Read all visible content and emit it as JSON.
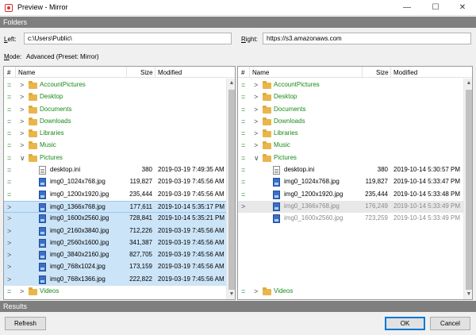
{
  "window": {
    "title": "Preview - Mirror",
    "controls": {
      "minimize": "—",
      "maximize": "☐",
      "close": "✕"
    }
  },
  "sections": {
    "folders": "Folders",
    "results": "Results"
  },
  "paths": {
    "left_label_u": "L",
    "left_label_rest": "eft:",
    "left_value": "c:\\Users\\Public\\",
    "right_label_u": "R",
    "right_label_rest": "ight:",
    "right_value": "https://s3.amazonaws.com",
    "mode_label_u": "M",
    "mode_label_rest": "ode:",
    "mode_value": "Advanced (Preset: Mirror)"
  },
  "columns": {
    "hash": "#",
    "name": "Name",
    "size": "Size",
    "modified": "Modified"
  },
  "left_rows": [
    {
      "mark": "=",
      "exp": ">",
      "type": "folder",
      "name": "AccountPictures",
      "size": "",
      "modified": "",
      "style": ""
    },
    {
      "mark": "=",
      "exp": ">",
      "type": "folder",
      "name": "Desktop",
      "size": "",
      "modified": "",
      "style": ""
    },
    {
      "mark": "=",
      "exp": ">",
      "type": "folder",
      "name": "Documents",
      "size": "",
      "modified": "",
      "style": ""
    },
    {
      "mark": "=",
      "exp": ">",
      "type": "folder",
      "name": "Downloads",
      "size": "",
      "modified": "",
      "style": ""
    },
    {
      "mark": "=",
      "exp": ">",
      "type": "folder",
      "name": "Libraries",
      "size": "",
      "modified": "",
      "style": ""
    },
    {
      "mark": "=",
      "exp": ">",
      "type": "folder",
      "name": "Music",
      "size": "",
      "modified": "",
      "style": ""
    },
    {
      "mark": "=",
      "exp": "∨",
      "type": "folder",
      "name": "Pictures",
      "size": "",
      "modified": "",
      "style": ""
    },
    {
      "mark": "=",
      "exp": "",
      "type": "file",
      "name": "desktop.ini",
      "size": "380",
      "modified": "2019-03-19 7:49:35 AM",
      "style": ""
    },
    {
      "mark": "=",
      "exp": "",
      "type": "image",
      "name": "img0_1024x768.jpg",
      "size": "119,827",
      "modified": "2019-03-19 7:45:56 AM",
      "style": ""
    },
    {
      "mark": "=",
      "exp": "",
      "type": "image",
      "name": "img0_1200x1920.jpg",
      "size": "235,444",
      "modified": "2019-03-19 7:45:56 AM",
      "style": ""
    },
    {
      "mark": ">",
      "exp": "",
      "type": "image",
      "name": "img0_1366x768.jpg",
      "size": "177,611",
      "modified": "2019-10-14 5:35:17 PM",
      "style": "seltop"
    },
    {
      "mark": ">",
      "exp": "",
      "type": "image",
      "name": "img0_1600x2560.jpg",
      "size": "728,841",
      "modified": "2019-10-14 5:35:21 PM",
      "style": "sel"
    },
    {
      "mark": ">",
      "exp": "",
      "type": "image",
      "name": "img0_2160x3840.jpg",
      "size": "712,226",
      "modified": "2019-03-19 7:45:56 AM",
      "style": "sel"
    },
    {
      "mark": ">",
      "exp": "",
      "type": "image",
      "name": "img0_2560x1600.jpg",
      "size": "341,387",
      "modified": "2019-03-19 7:45:56 AM",
      "style": "sel"
    },
    {
      "mark": ">",
      "exp": "",
      "type": "image",
      "name": "img0_3840x2160.jpg",
      "size": "827,705",
      "modified": "2019-03-19 7:45:56 AM",
      "style": "sel"
    },
    {
      "mark": ">",
      "exp": "",
      "type": "image",
      "name": "img0_768x1024.jpg",
      "size": "173,159",
      "modified": "2019-03-19 7:45:56 AM",
      "style": "sel"
    },
    {
      "mark": ">",
      "exp": "",
      "type": "image",
      "name": "img0_768x1366.jpg",
      "size": "222,822",
      "modified": "2019-03-19 7:45:56 AM",
      "style": "sel"
    },
    {
      "mark": "=",
      "exp": ">",
      "type": "folder",
      "name": "Videos",
      "size": "",
      "modified": "",
      "style": ""
    }
  ],
  "right_rows": [
    {
      "mark": "=",
      "exp": ">",
      "type": "folder",
      "name": "AccountPictures",
      "size": "",
      "modified": "",
      "style": ""
    },
    {
      "mark": "=",
      "exp": ">",
      "type": "folder",
      "name": "Desktop",
      "size": "",
      "modified": "",
      "style": ""
    },
    {
      "mark": "=",
      "exp": ">",
      "type": "folder",
      "name": "Documents",
      "size": "",
      "modified": "",
      "style": ""
    },
    {
      "mark": "=",
      "exp": ">",
      "type": "folder",
      "name": "Downloads",
      "size": "",
      "modified": "",
      "style": ""
    },
    {
      "mark": "=",
      "exp": ">",
      "type": "folder",
      "name": "Libraries",
      "size": "",
      "modified": "",
      "style": ""
    },
    {
      "mark": "=",
      "exp": ">",
      "type": "folder",
      "name": "Music",
      "size": "",
      "modified": "",
      "style": ""
    },
    {
      "mark": "=",
      "exp": "∨",
      "type": "folder",
      "name": "Pictures",
      "size": "",
      "modified": "",
      "style": ""
    },
    {
      "mark": "=",
      "exp": "",
      "type": "file",
      "name": "desktop.ini",
      "size": "380",
      "modified": "2019-10-14 5:30:57 PM",
      "style": ""
    },
    {
      "mark": "=",
      "exp": "",
      "type": "image",
      "name": "img0_1024x768.jpg",
      "size": "119,827",
      "modified": "2019-10-14 5:33:47 PM",
      "style": ""
    },
    {
      "mark": "=",
      "exp": "",
      "type": "image",
      "name": "img0_1200x1920.jpg",
      "size": "235,444",
      "modified": "2019-10-14 5:33:48 PM",
      "style": ""
    },
    {
      "mark": ">",
      "exp": "",
      "type": "image",
      "name": "img0_1366x768.jpg",
      "size": "176,249",
      "modified": "2019-10-14 5:33:49 PM",
      "style": "graysel"
    },
    {
      "mark": "",
      "exp": "",
      "type": "image",
      "name": "img0_1600x2560.jpg",
      "size": "723,259",
      "modified": "2019-10-14 5:33:49 PM",
      "style": "gray"
    },
    {
      "mark": "",
      "exp": "",
      "type": "none",
      "name": "",
      "size": "",
      "modified": "",
      "style": ""
    },
    {
      "mark": "",
      "exp": "",
      "type": "none",
      "name": "",
      "size": "",
      "modified": "",
      "style": ""
    },
    {
      "mark": "",
      "exp": "",
      "type": "none",
      "name": "",
      "size": "",
      "modified": "",
      "style": ""
    },
    {
      "mark": "",
      "exp": "",
      "type": "none",
      "name": "",
      "size": "",
      "modified": "",
      "style": ""
    },
    {
      "mark": "",
      "exp": "",
      "type": "none",
      "name": "",
      "size": "",
      "modified": "",
      "style": ""
    },
    {
      "mark": "=",
      "exp": ">",
      "type": "folder",
      "name": "Videos",
      "size": "",
      "modified": "",
      "style": ""
    }
  ],
  "scroll": {
    "up": "▲",
    "down": "▼"
  },
  "buttons": {
    "refresh": "Refresh",
    "ok": "OK",
    "cancel": "Cancel"
  }
}
